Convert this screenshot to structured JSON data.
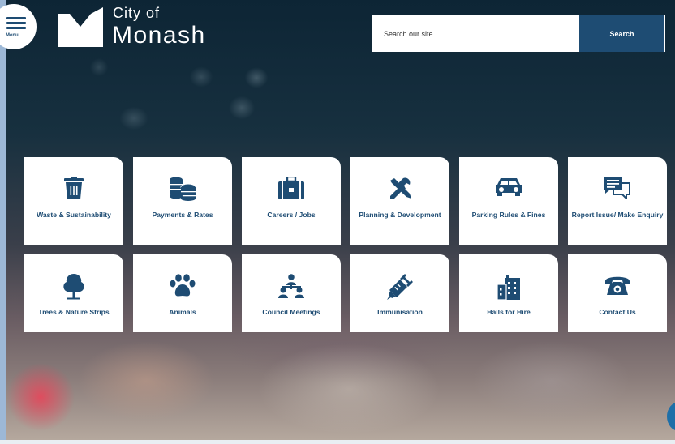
{
  "header": {
    "menu_label": "Menu",
    "brand_city": "City of",
    "brand_name": "Monash"
  },
  "search": {
    "placeholder": "Search our site",
    "button_label": "Search"
  },
  "colors": {
    "brand": "#1e4c73",
    "tile_bg": "#ffffff"
  },
  "tiles": [
    {
      "label": "Waste & Sustainability",
      "icon": "trash-bin-icon"
    },
    {
      "label": "Payments & Rates",
      "icon": "coins-icon"
    },
    {
      "label": "Careers / Jobs",
      "icon": "briefcase-icon"
    },
    {
      "label": "Planning & Development",
      "icon": "tools-icon"
    },
    {
      "label": "Parking Rules & Fines",
      "icon": "car-icon"
    },
    {
      "label": "Report Issue/ Make Enquiry",
      "icon": "chat-bubbles-icon"
    },
    {
      "label": "Trees & Nature Strips",
      "icon": "tree-icon"
    },
    {
      "label": "Animals",
      "icon": "paw-icon"
    },
    {
      "label": "Council Meetings",
      "icon": "people-meeting-icon"
    },
    {
      "label": "Immunisation",
      "icon": "syringe-icon"
    },
    {
      "label": "Halls for Hire",
      "icon": "buildings-icon"
    },
    {
      "label": "Contact Us",
      "icon": "phone-icon"
    }
  ]
}
